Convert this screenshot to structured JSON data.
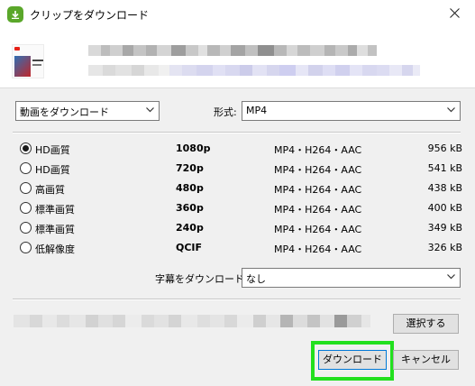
{
  "window": {
    "title": "クリップをダウンロード"
  },
  "type_select": {
    "value": "動画をダウンロード"
  },
  "format": {
    "label": "形式:",
    "value": "MP4"
  },
  "qualities": [
    {
      "label": "HD画質",
      "resolution": "1080p",
      "codec": "MP4・H264・AAC",
      "size": "956 kB",
      "selected": true
    },
    {
      "label": "HD画質",
      "resolution": "720p",
      "codec": "MP4・H264・AAC",
      "size": "541 kB",
      "selected": false
    },
    {
      "label": "高画質",
      "resolution": "480p",
      "codec": "MP4・H264・AAC",
      "size": "438 kB",
      "selected": false
    },
    {
      "label": "標準画質",
      "resolution": "360p",
      "codec": "MP4・H264・AAC",
      "size": "400 kB",
      "selected": false
    },
    {
      "label": "標準画質",
      "resolution": "240p",
      "codec": "MP4・H264・AAC",
      "size": "349 kB",
      "selected": false
    },
    {
      "label": "低解像度",
      "resolution": "QCIF",
      "codec": "MP4・H264・AAC",
      "size": "326 kB",
      "selected": false
    }
  ],
  "subtitles": {
    "label": "字幕をダウンロード:",
    "value": "なし"
  },
  "buttons": {
    "select": "選択する",
    "download": "ダウンロード",
    "cancel": "キャンセル"
  },
  "colors": {
    "highlight": "#22e01e",
    "app_icon": "#5aa72a"
  },
  "icons": {
    "app": "download-app-icon",
    "close": "close-icon",
    "dropdown": "chevron-down-icon"
  }
}
